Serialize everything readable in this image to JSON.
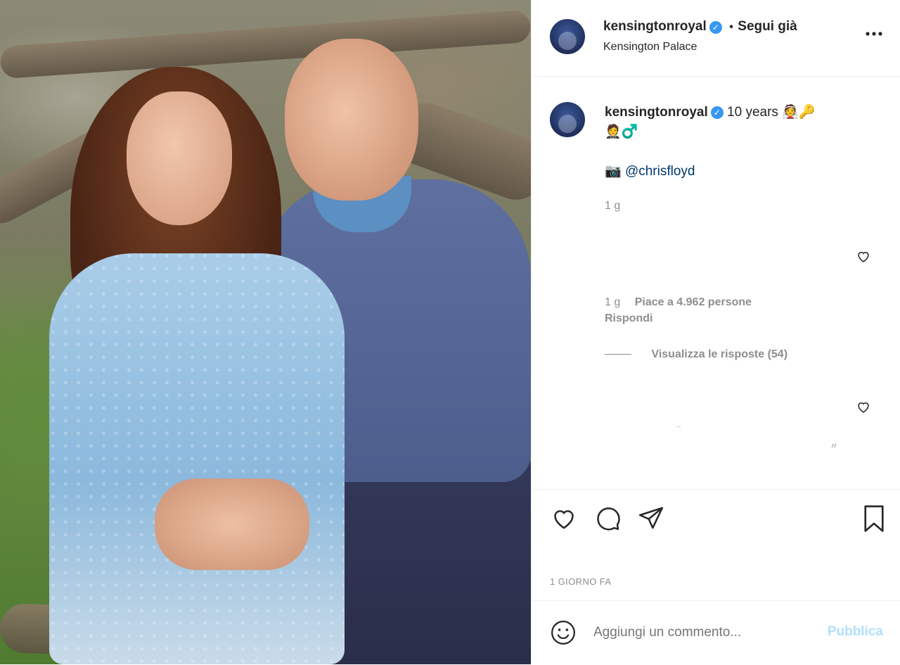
{
  "header": {
    "username": "kensingtonroyal",
    "follow_label": "Segui già",
    "bullet": "•",
    "location": "Kensington Palace",
    "more_icon": "more-dots-icon"
  },
  "caption": {
    "username": "kensingtonroyal",
    "text": "10 years 👰🔑",
    "line2": "🤵♂️",
    "credit_emoji": "📷",
    "credit_handle": "@chrisfloyd",
    "age": "1 g"
  },
  "comment": {
    "age": "1 g",
    "likes": "Piace a 4.962 persone",
    "reply_label": "Rispondi",
    "view_replies": "Visualizza le risposte (54)"
  },
  "actions": {
    "timestamp": "1 GIORNO FA"
  },
  "composer": {
    "placeholder": "Aggiungi un commento...",
    "publish": "Pubblica"
  },
  "colors": {
    "link": "#00376b",
    "muted": "#8e8e8e",
    "verified": "#3897f0",
    "publish_disabled": "#b2dffc"
  }
}
